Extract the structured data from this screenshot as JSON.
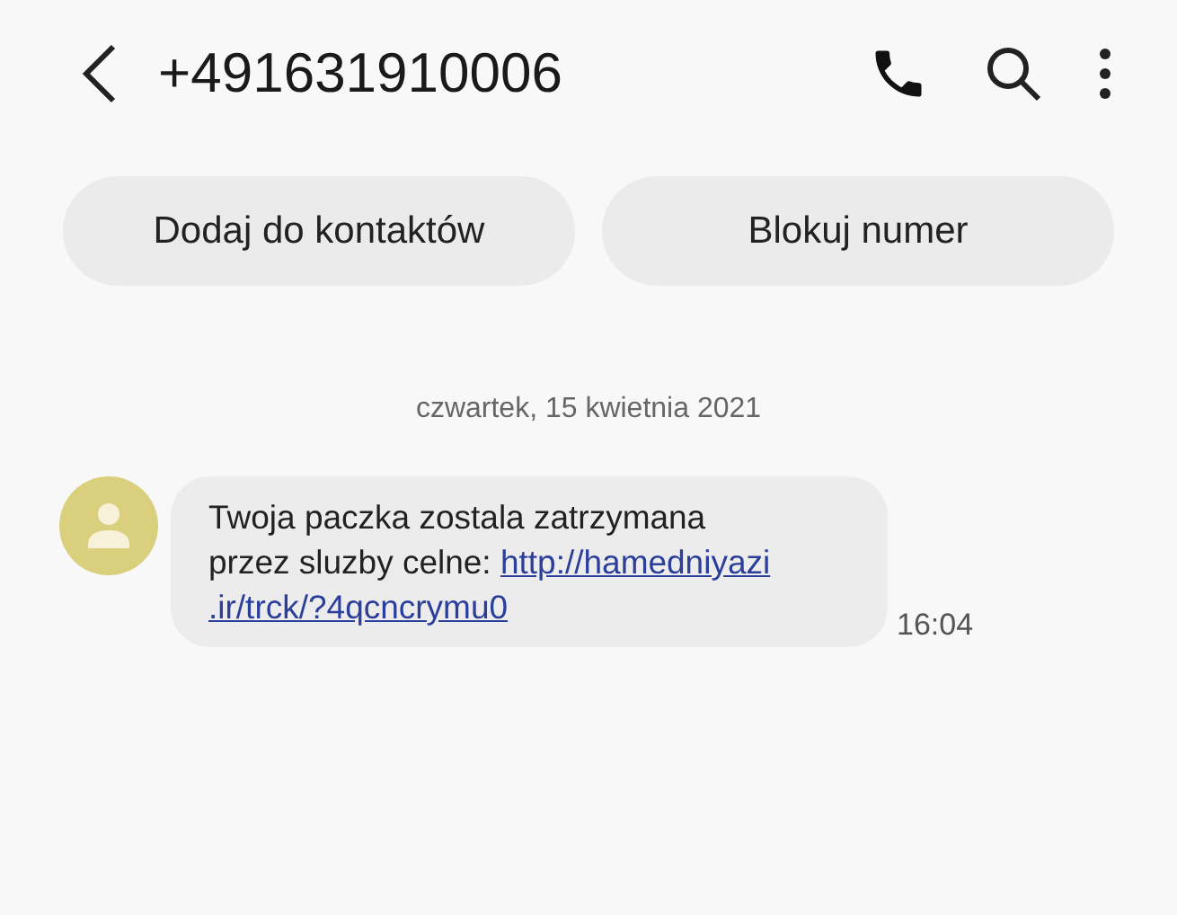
{
  "header": {
    "title": "+491631910006"
  },
  "actions": [
    {
      "label": "Dodaj do kontaktów"
    },
    {
      "label": "Blokuj numer"
    }
  ],
  "date_separator": "czwartek, 15 kwietnia 2021",
  "messages": [
    {
      "text": "Twoja paczka zostala zatrzymana\nprzez sluzby celne: ",
      "link_lines": [
        "http://hamedniyazi",
        ".ir/trck/?4qcncrymu0"
      ],
      "time": "16:04",
      "color": "#d9cf7d"
    }
  ]
}
